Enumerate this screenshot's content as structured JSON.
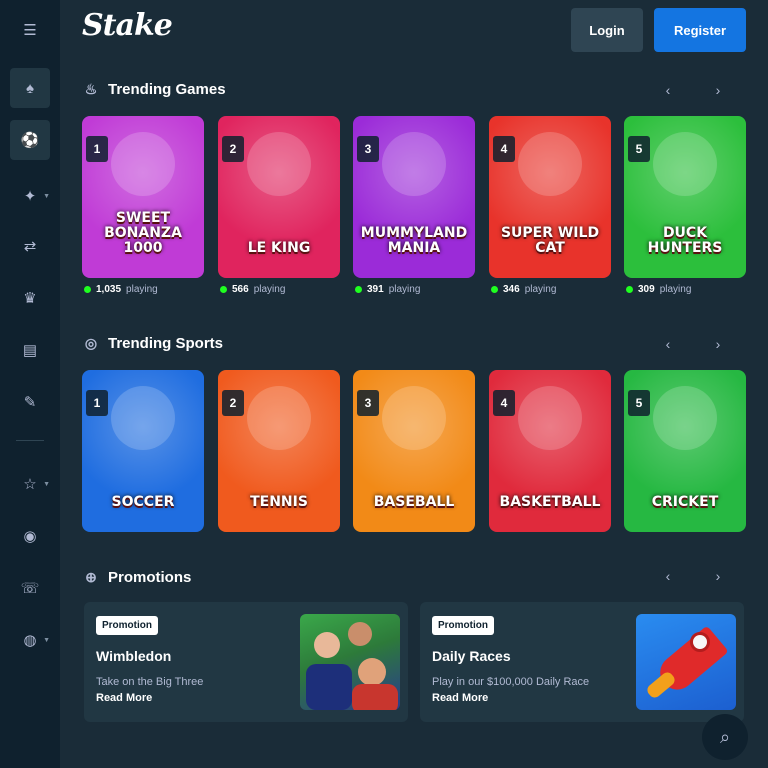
{
  "header": {
    "logo": "Stake",
    "login_label": "Login",
    "register_label": "Register"
  },
  "sidebar": {
    "items": [
      {
        "icon": "menu-icon"
      },
      {
        "icon": "casino-icon"
      },
      {
        "icon": "sports-icon"
      },
      {
        "icon": "gift-icon"
      },
      {
        "icon": "affiliate-icon"
      },
      {
        "icon": "vip-icon"
      },
      {
        "icon": "blog-icon"
      },
      {
        "icon": "forum-icon"
      },
      {
        "icon": "sponsorship-icon"
      },
      {
        "icon": "responsible-gambling-icon"
      },
      {
        "icon": "live-support-icon"
      },
      {
        "icon": "language-icon"
      }
    ]
  },
  "trending_games": {
    "title": "Trending Games",
    "cards": [
      {
        "rank": "1",
        "title": "Sweet Bonanza 1000",
        "players": "1,035",
        "players_suffix": "playing",
        "bg": "#c03bd6"
      },
      {
        "rank": "2",
        "title": "Le King",
        "players": "566",
        "players_suffix": "playing",
        "bg": "#e0245e"
      },
      {
        "rank": "3",
        "title": "Mummyland Mania",
        "players": "391",
        "players_suffix": "playing",
        "bg": "#9b2bd8"
      },
      {
        "rank": "4",
        "title": "Super Wild Cat",
        "players": "346",
        "players_suffix": "playing",
        "bg": "#e8332b"
      },
      {
        "rank": "5",
        "title": "Duck Hunters",
        "players": "309",
        "players_suffix": "playing",
        "bg": "#2cbf3c"
      }
    ]
  },
  "trending_sports": {
    "title": "Trending Sports",
    "cards": [
      {
        "rank": "1",
        "title": "Soccer",
        "bg": "#1f6de0"
      },
      {
        "rank": "2",
        "title": "Tennis",
        "bg": "#f05a1e"
      },
      {
        "rank": "3",
        "title": "Baseball",
        "bg": "#f28a17"
      },
      {
        "rank": "4",
        "title": "Basketball",
        "bg": "#e02a3c"
      },
      {
        "rank": "5",
        "title": "Cricket",
        "bg": "#26b842"
      }
    ]
  },
  "promotions": {
    "title": "Promotions",
    "items": [
      {
        "tag": "Promotion",
        "title": "Wimbledon",
        "desc": "Take on the Big Three",
        "link": "Read More"
      },
      {
        "tag": "Promotion",
        "title": "Daily Races",
        "desc": "Play in our $100,000 Daily Race",
        "link": "Read More"
      }
    ]
  }
}
